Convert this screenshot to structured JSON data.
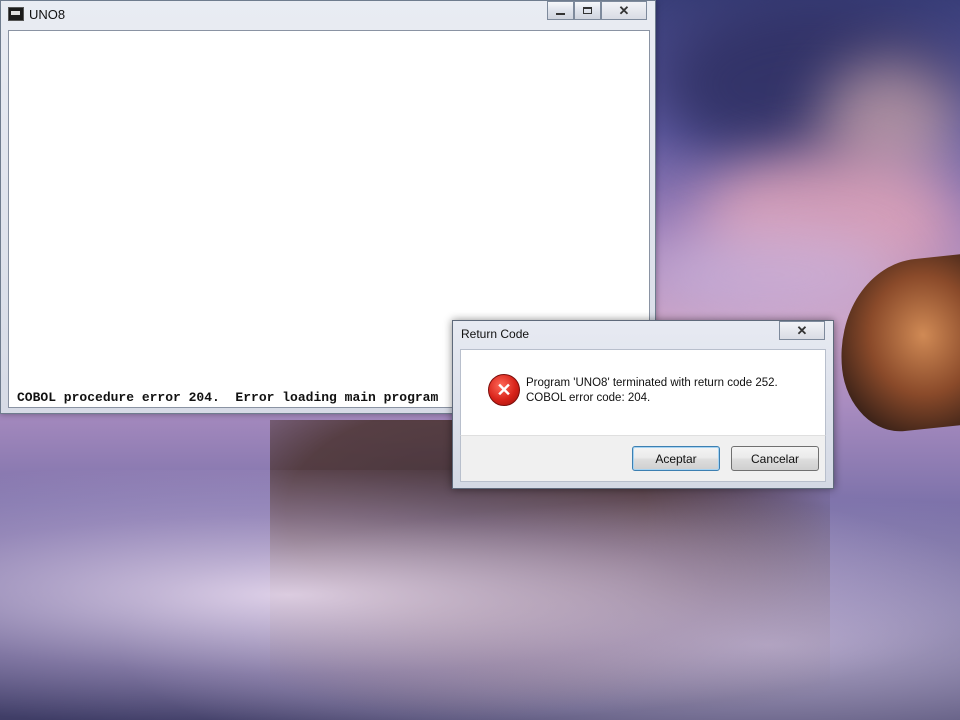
{
  "console_window": {
    "title": "UNO8",
    "error_line": "COBOL procedure error 204.  Error loading main program"
  },
  "dialog": {
    "title": "Return Code",
    "message_line1": "Program 'UNO8' terminated with return code 252.",
    "message_line2": "COBOL error code: 204.",
    "ok_label": "Aceptar",
    "cancel_label": "Cancelar",
    "icon": "error-icon"
  },
  "caption_glyphs": {
    "close": "✕"
  }
}
